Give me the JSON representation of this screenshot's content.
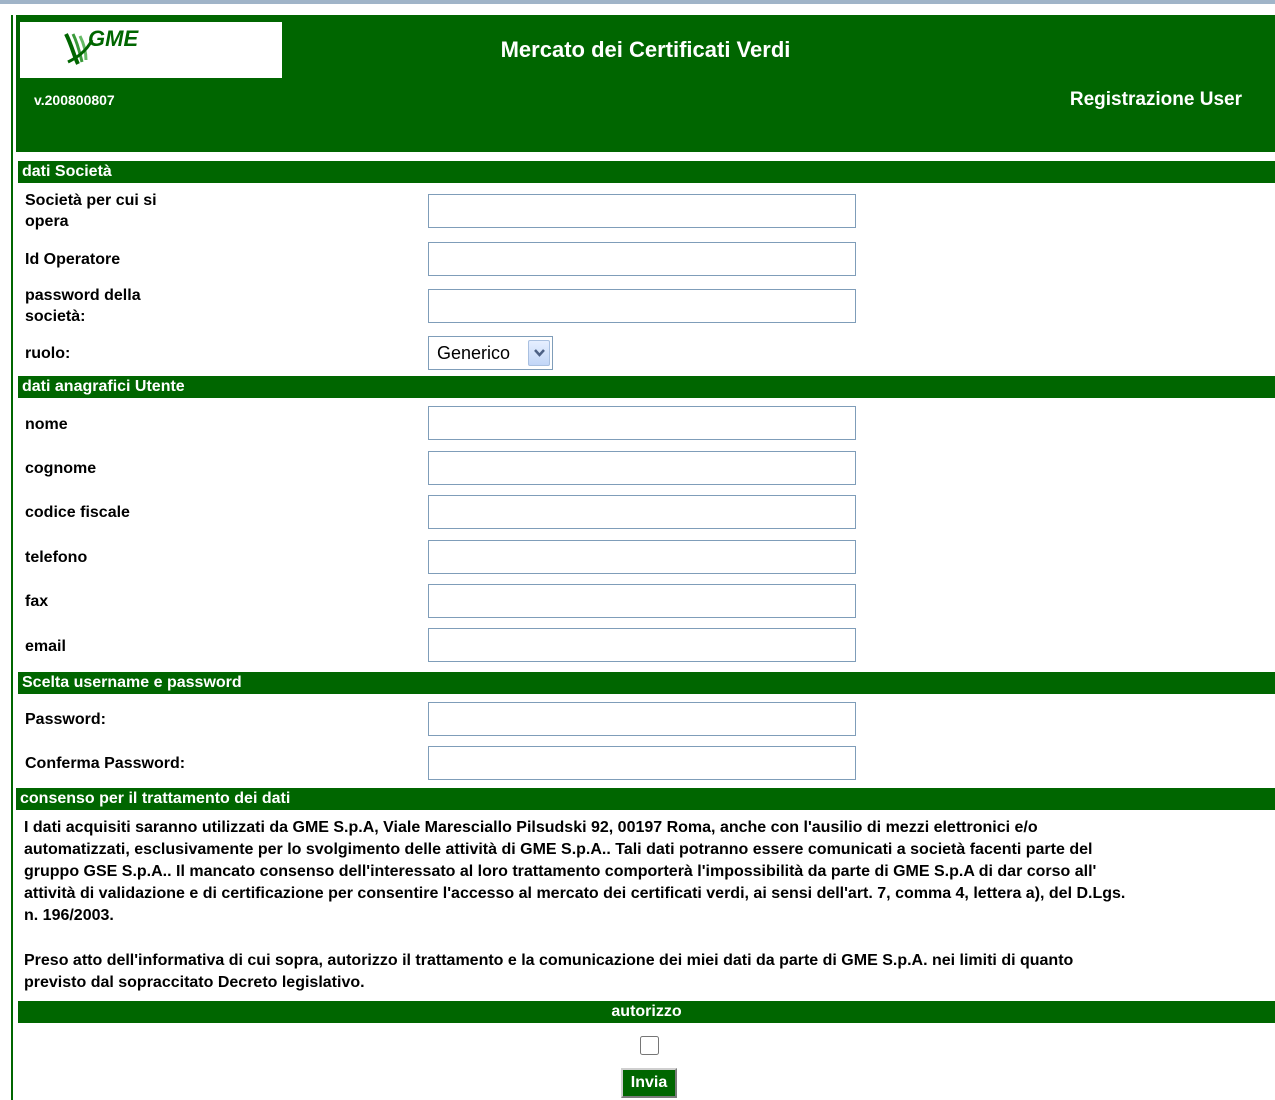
{
  "header": {
    "logo_text": "GME",
    "app_title": "Mercato dei Certificati Verdi",
    "version": "v.200800807",
    "page_title": "Registrazione User"
  },
  "section_company": {
    "title": "dati Società",
    "fields": [
      {
        "label_line1": "Società per cui si",
        "label_line2": "opera",
        "value": ""
      },
      {
        "label": "Id Operatore",
        "value": ""
      },
      {
        "label_line1": "password della",
        "label_line2": "società:",
        "value": ""
      }
    ],
    "role_label": "ruolo:",
    "role_value": "Generico"
  },
  "section_user": {
    "title": "dati anagrafici Utente",
    "fields": [
      {
        "label": "nome",
        "value": ""
      },
      {
        "label": "cognome",
        "value": ""
      },
      {
        "label": "codice fiscale",
        "value": ""
      },
      {
        "label": "telefono",
        "value": ""
      },
      {
        "label": "fax",
        "value": ""
      },
      {
        "label": "email",
        "value": ""
      }
    ]
  },
  "section_credentials": {
    "title": "Scelta username e password",
    "fields": [
      {
        "label": "Password:",
        "value": ""
      },
      {
        "label": "Conferma Password:",
        "value": ""
      }
    ]
  },
  "section_consent": {
    "title": "consenso per il trattamento dei dati",
    "lines1": [
      "I dati acquisiti saranno utilizzati da GME S.p.A, Viale Maresciallo Pilsudski 92, 00197 Roma, anche con l'ausilio di mezzi elettronici e/o",
      "automatizzati, esclusivamente per lo svolgimento delle attività di GME S.p.A.. Tali dati potranno essere comunicati a società facenti parte del",
      "gruppo GSE S.p.A.. Il mancato consenso dell'interessato al loro trattamento comporterà l'impossibilità da parte di GME S.p.A di dar corso all'",
      "attività di validazione e di certificazione per consentire l'accesso al mercato dei certificati verdi, ai sensi dell'art. 7, comma 4, lettera a), del D.Lgs.",
      "n. 196/2003."
    ],
    "lines2": [
      "Preso atto dell'informativa di cui sopra, autorizzo il trattamento e la comunicazione dei miei dati da parte di GME S.p.A. nei limiti di quanto",
      "previsto dal sopraccitato Decreto legislativo."
    ],
    "authorize_label": "autorizzo",
    "authorize_checked": false,
    "submit_label": "Invia"
  },
  "colors": {
    "primary_green": "#006600",
    "input_border": "#7f9db9"
  }
}
